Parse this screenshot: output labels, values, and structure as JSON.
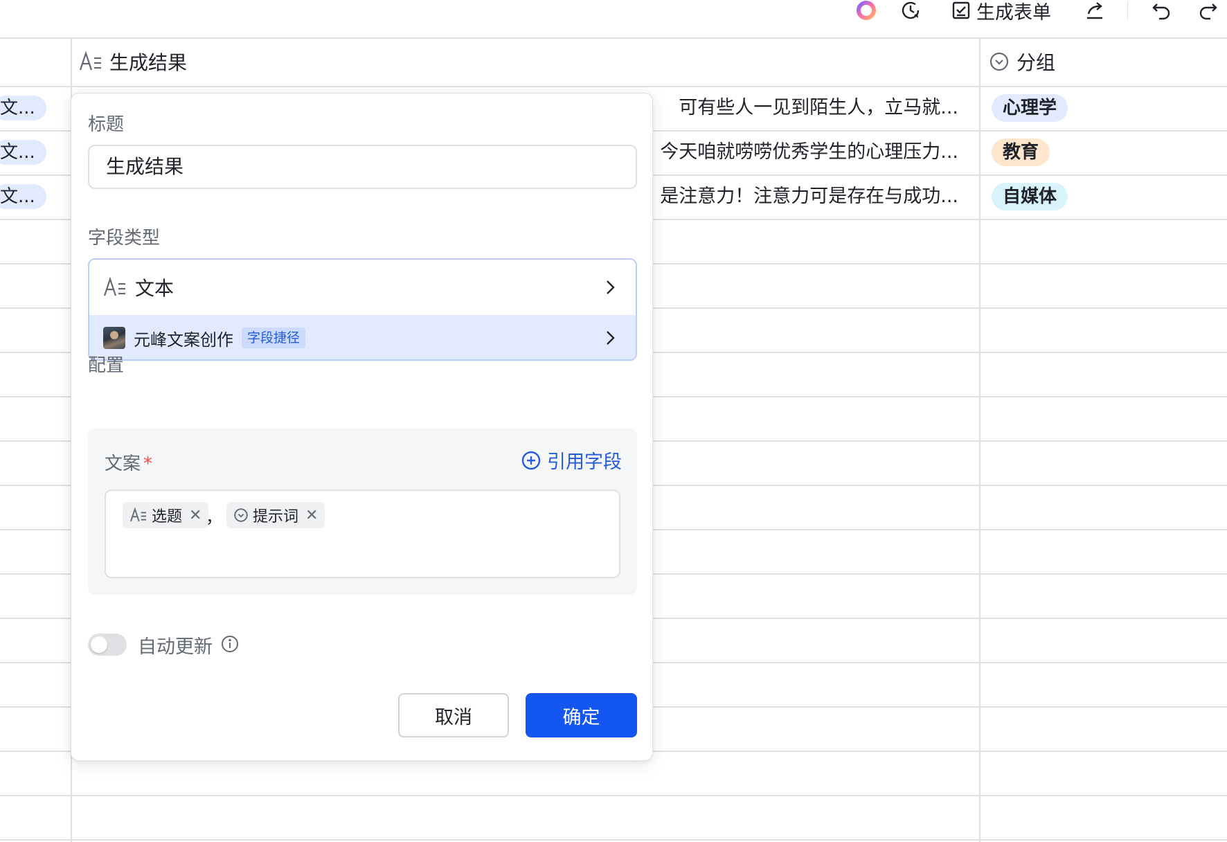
{
  "toolbar": {
    "generate_form_label": "生成表单",
    "icons": [
      "ai-orb-icon",
      "history-icon",
      "form-check-icon",
      "share-icon",
      "undo-icon",
      "redo-icon"
    ]
  },
  "columns": [
    {
      "label": "生成结果",
      "icon": "text-field-icon"
    },
    {
      "label": "分组",
      "icon": "single-select-icon"
    }
  ],
  "rows": [
    {
      "left_pill": "文...",
      "result_text": "可有些人一见到陌生人，立马就...",
      "group": "心理学",
      "group_color": "#e1eaff"
    },
    {
      "left_pill": "文...",
      "result_text": "今天咱就唠唠优秀学生的心理压力...",
      "group": "教育",
      "group_color": "#fee7cd"
    },
    {
      "left_pill": "文...",
      "result_text": "是注意力！注意力可是存在与成功...",
      "group": "自媒体",
      "group_color": "#d9f3fd"
    }
  ],
  "dialog": {
    "title_label": "标题",
    "title_value": "生成结果",
    "field_type_label": "字段类型",
    "field_type_value": "文本",
    "shortcut_name": "元峰文案创作",
    "shortcut_badge": "字段捷径",
    "config_label": "配置",
    "config_field_label": "文案",
    "required_mark": "*",
    "ref_field_button": "引用字段",
    "formula_chips": [
      {
        "label": "选题",
        "icon": "text-field-icon"
      },
      {
        "label": "提示词",
        "icon": "single-select-icon"
      }
    ],
    "separator": "，",
    "remove_glyph": "✕",
    "auto_update_label": "自动更新",
    "auto_update_on": false,
    "cancel_label": "取消",
    "confirm_label": "确定"
  },
  "colors": {
    "primary": "#1456f0",
    "link": "#245bdb",
    "border": "#dee0e3",
    "required": "#f54a45"
  }
}
